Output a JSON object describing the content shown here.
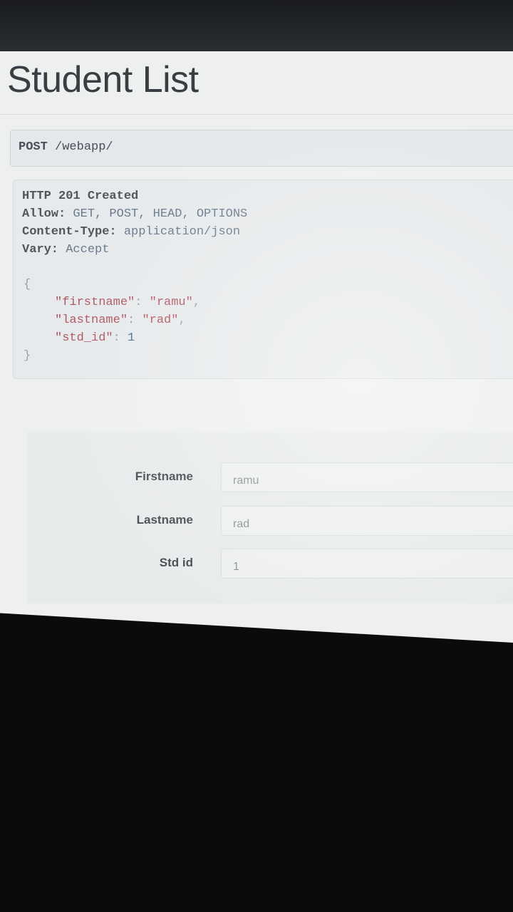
{
  "page": {
    "title": "Student List"
  },
  "request": {
    "method": "POST",
    "path": "/webapp/"
  },
  "response": {
    "status": "HTTP 201 Created",
    "headers": [
      {
        "key": "Allow:",
        "value": "GET, POST, HEAD, OPTIONS"
      },
      {
        "key": "Content-Type:",
        "value": "application/json"
      },
      {
        "key": "Vary:",
        "value": "Accept"
      }
    ],
    "json": {
      "open": "{",
      "close": "}",
      "lines": [
        {
          "key": "\"firstname\"",
          "sep": ": ",
          "value": "\"ramu\"",
          "tail": ","
        },
        {
          "key": "\"lastname\"",
          "sep": ": ",
          "value": "\"rad\"",
          "tail": ","
        },
        {
          "key": "\"std_id\"",
          "sep": ": ",
          "value": "1",
          "tail": ""
        }
      ]
    }
  },
  "form": {
    "fields": [
      {
        "label": "Firstname",
        "value": "ramu"
      },
      {
        "label": "Lastname",
        "value": "rad"
      },
      {
        "label": "Std id",
        "value": "1"
      }
    ]
  },
  "colors": {
    "background": "#eef0f0",
    "title": "#3a3d42",
    "json_string": "#b0565f",
    "header_value": "#6a7a8c"
  }
}
